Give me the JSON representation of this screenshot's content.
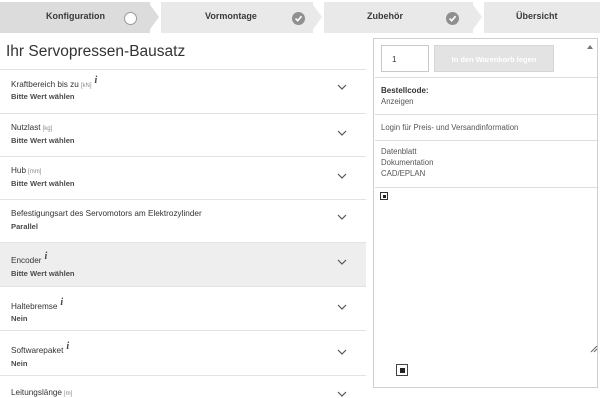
{
  "steps": [
    {
      "label": "Konfiguration",
      "state": "active"
    },
    {
      "label": "Vormontage",
      "state": "done"
    },
    {
      "label": "Zubehör",
      "state": "done"
    },
    {
      "label": "Übersicht",
      "state": "pending"
    }
  ],
  "config": {
    "title": "Ihr Servopressen-Bausatz",
    "rows": [
      {
        "name": "Kraftbereich bis zu",
        "unit": "[kN]",
        "info": "i",
        "value": "Bitte Wert wählen"
      },
      {
        "name": "Nutzlast",
        "unit": "[kg]",
        "info": "",
        "value": "Bitte Wert wählen"
      },
      {
        "name": "Hub",
        "unit": "[mm]",
        "info": "",
        "value": "Bitte Wert wählen"
      },
      {
        "name": "Befestigungsart des Servomotors am Elektrozylinder",
        "unit": "",
        "info": "",
        "value": "Parallel"
      },
      {
        "name": "Encoder",
        "unit": "",
        "info": "i",
        "value": "Bitte Wert wählen"
      },
      {
        "name": "Haltebremse",
        "unit": "",
        "info": "i",
        "value": "Nein"
      },
      {
        "name": "Softwarepaket",
        "unit": "",
        "info": "i",
        "value": "Nein"
      },
      {
        "name": "Leitungslänge",
        "unit": "[m]",
        "info": "",
        "value": ""
      }
    ]
  },
  "panel": {
    "quantity": "1",
    "cart_button": "In den Warenkorb legen",
    "order_code_label": "Bestellcode:",
    "order_code_link": "Anzeigen",
    "login_link": "Login für Preis- und Versandinformation",
    "documents": [
      "Datenblatt",
      "Dokumentation",
      "CAD/EPLAN"
    ]
  },
  "colors": {
    "step_bg": "#e9e9e9",
    "step_active_bg": "#dcdcdc",
    "highlight_row": "#eeeeee",
    "check_fill": "#8f8f8f"
  },
  "icons": {
    "info": "info-i-icon",
    "chevron": "chevron-down-icon",
    "check": "check-circle-icon",
    "radio": "radio-empty-icon",
    "resize": "resize-icon",
    "preview": "image-placeholder-icon"
  }
}
